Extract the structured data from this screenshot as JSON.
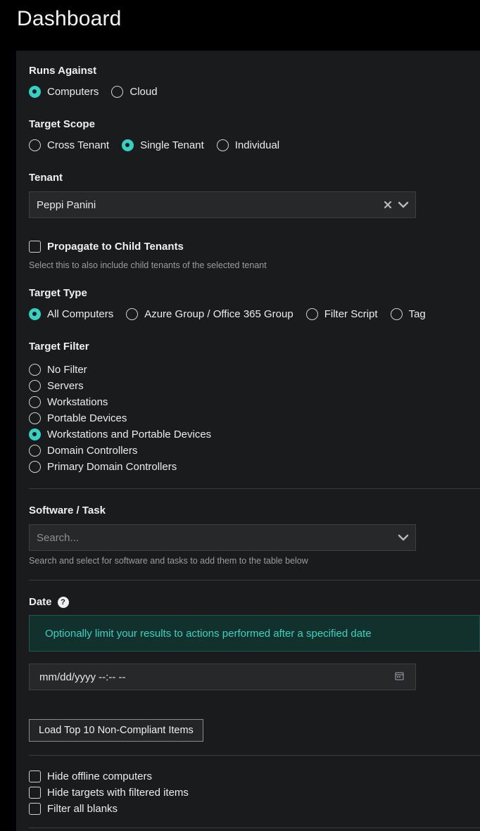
{
  "page": {
    "title": "Dashboard"
  },
  "runs_against": {
    "label": "Runs Against",
    "options": [
      {
        "label": "Computers",
        "selected": true
      },
      {
        "label": "Cloud",
        "selected": false
      }
    ]
  },
  "target_scope": {
    "label": "Target Scope",
    "options": [
      {
        "label": "Cross Tenant",
        "selected": false
      },
      {
        "label": "Single Tenant",
        "selected": true
      },
      {
        "label": "Individual",
        "selected": false
      }
    ]
  },
  "tenant": {
    "label": "Tenant",
    "value": "Peppi Panini"
  },
  "propagate": {
    "label": "Propagate to Child Tenants",
    "checked": false,
    "hint": "Select this to also include child tenants of the selected tenant"
  },
  "target_type": {
    "label": "Target Type",
    "options": [
      {
        "label": "All Computers",
        "selected": true
      },
      {
        "label": "Azure Group / Office 365 Group",
        "selected": false
      },
      {
        "label": "Filter Script",
        "selected": false
      },
      {
        "label": "Tag",
        "selected": false
      }
    ]
  },
  "target_filter": {
    "label": "Target Filter",
    "options": [
      {
        "label": "No Filter",
        "selected": false
      },
      {
        "label": "Servers",
        "selected": false
      },
      {
        "label": "Workstations",
        "selected": false
      },
      {
        "label": "Portable Devices",
        "selected": false
      },
      {
        "label": "Workstations and Portable Devices",
        "selected": true
      },
      {
        "label": "Domain Controllers",
        "selected": false
      },
      {
        "label": "Primary Domain Controllers",
        "selected": false
      }
    ]
  },
  "software_task": {
    "label": "Software / Task",
    "placeholder": "Search...",
    "hint": "Search and select for software and tasks to add them to the table below"
  },
  "date": {
    "label": "Date",
    "help": "?",
    "alert": "Optionally limit your results to actions performed after a specified date",
    "input_placeholder": "mm/dd/yyyy --:-- --"
  },
  "load_button": {
    "label": "Load Top 10 Non-Compliant Items"
  },
  "options_checks": [
    {
      "label": "Hide offline computers",
      "checked": false
    },
    {
      "label": "Hide targets with filtered items",
      "checked": false
    },
    {
      "label": "Filter all blanks",
      "checked": false
    }
  ],
  "colors": {
    "accent": "#35d1c3",
    "background": "#000000",
    "panel": "#1a1b1c"
  }
}
